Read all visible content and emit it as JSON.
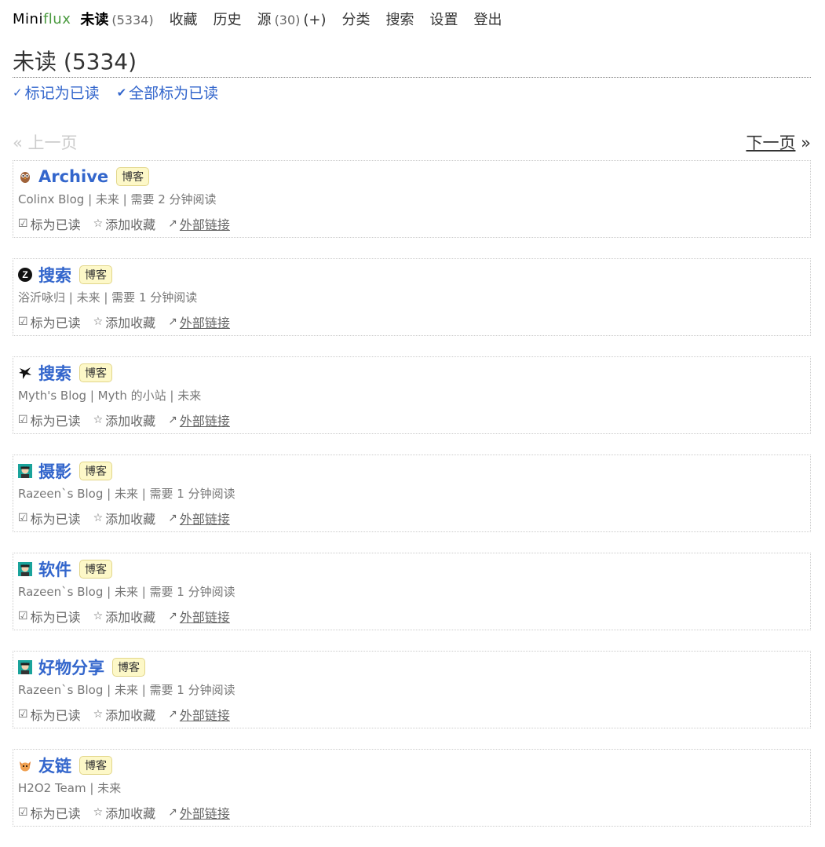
{
  "app": {
    "logo_a": "Mini",
    "logo_b": "flux"
  },
  "nav": {
    "unread": "未读",
    "unread_count": "(5334)",
    "starred": "收藏",
    "history": "历史",
    "feeds": "源",
    "feeds_count": "(30)",
    "feeds_add": "(+)",
    "categories": "分类",
    "search": "搜索",
    "settings": "设置",
    "logout": "登出"
  },
  "page": {
    "title": "未读 (5334)",
    "mark_page": "标记为已读",
    "mark_all": "全部标为已读"
  },
  "pager": {
    "prev": "« 上一页",
    "next": "下一页",
    "next_arrow": "»"
  },
  "entry_actions": {
    "mark_read": "标为已读",
    "star": "添加收藏",
    "external": "外部链接"
  },
  "entries": [
    {
      "title": "Archive",
      "badge": "博客",
      "meta": "Colinx Blog | 未来 | 需要 2 分钟阅读",
      "icon": "owl-favicon"
    },
    {
      "title": "搜索",
      "badge": "博客",
      "meta": "浴沂咏归 | 未来 | 需要 1 分钟阅读",
      "icon": "z-favicon"
    },
    {
      "title": "搜索",
      "badge": "博客",
      "meta": "Myth's Blog | Myth 的小站 | 未来",
      "icon": "dragon-favicon"
    },
    {
      "title": "摄影",
      "badge": "博客",
      "meta": "Razeen`s Blog | 未来 | 需要 1 分钟阅读",
      "icon": "avatar-favicon"
    },
    {
      "title": "软件",
      "badge": "博客",
      "meta": "Razeen`s Blog | 未来 | 需要 1 分钟阅读",
      "icon": "avatar-favicon"
    },
    {
      "title": "好物分享",
      "badge": "博客",
      "meta": "Razeen`s Blog | 未来 | 需要 1 分钟阅读",
      "icon": "avatar-favicon"
    },
    {
      "title": "友链",
      "badge": "博客",
      "meta": "H2O2 Team | 未来",
      "icon": "cat-favicon"
    }
  ],
  "colors": {
    "link": "#3366cc",
    "badge_bg": "#fdf8c8",
    "logo_accent": "#4a9a3f"
  }
}
